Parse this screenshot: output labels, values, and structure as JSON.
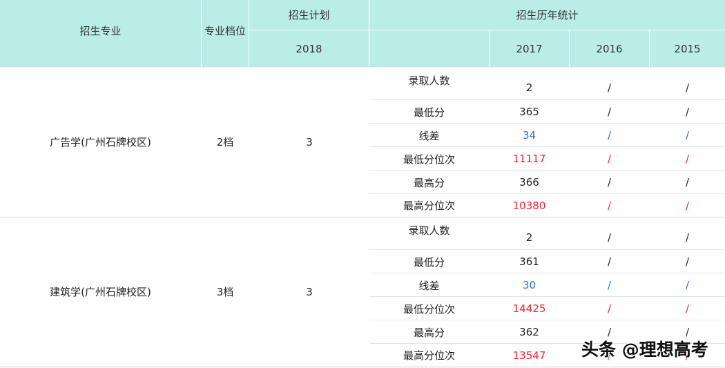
{
  "header": {
    "major": "招生专业",
    "tier": "专业档位",
    "plan": "招生计划",
    "plan_year": "2018",
    "history": "招生历年统计",
    "years": [
      "2017",
      "2016",
      "2015"
    ]
  },
  "colors": {
    "header_bg": "#bbede7",
    "blue": "#2a6fd8",
    "red": "#e8262e"
  },
  "rows": [
    {
      "major": "广告学(广州石牌校区)",
      "tier": "2档",
      "plan": "3",
      "stats": [
        {
          "label": "录取人数",
          "values": [
            "2",
            "/",
            "/"
          ],
          "color": "normal"
        },
        {
          "label": "最低分",
          "values": [
            "365",
            "/",
            "/"
          ],
          "color": "normal"
        },
        {
          "label": "线差",
          "values": [
            "34",
            "/",
            "/"
          ],
          "color": "blue"
        },
        {
          "label": "最低分位次",
          "values": [
            "11117",
            "/",
            "/"
          ],
          "color": "red"
        },
        {
          "label": "最高分",
          "values": [
            "366",
            "/",
            "/"
          ],
          "color": "normal"
        },
        {
          "label": "最高分位次",
          "values": [
            "10380",
            "/",
            "/"
          ],
          "color": "red"
        }
      ]
    },
    {
      "major": "建筑学(广州石牌校区)",
      "tier": "3档",
      "plan": "3",
      "stats": [
        {
          "label": "录取人数",
          "values": [
            "2",
            "/",
            "/"
          ],
          "color": "normal"
        },
        {
          "label": "最低分",
          "values": [
            "361",
            "/",
            "/"
          ],
          "color": "normal"
        },
        {
          "label": "线差",
          "values": [
            "30",
            "/",
            "/"
          ],
          "color": "blue"
        },
        {
          "label": "最低分位次",
          "values": [
            "14425",
            "/",
            "/"
          ],
          "color": "red"
        },
        {
          "label": "最高分",
          "values": [
            "362",
            "/",
            "/"
          ],
          "color": "normal"
        },
        {
          "label": "最高分位次",
          "values": [
            "13547",
            "/",
            "/"
          ],
          "color": "red"
        }
      ]
    }
  ],
  "watermark": "头条 @理想高考"
}
